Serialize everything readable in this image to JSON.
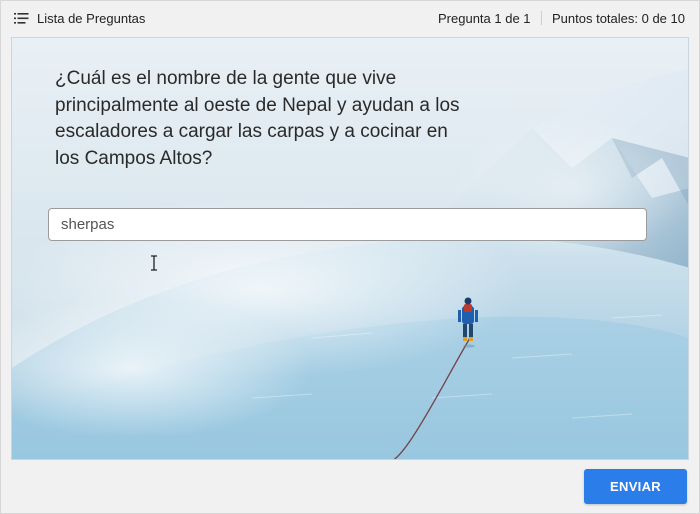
{
  "header": {
    "question_list_label": "Lista de Preguntas",
    "question_list_icon": "list-icon",
    "question_counter": "Pregunta 1 de 1",
    "total_points": "Puntos totales: 0 de 10"
  },
  "question": {
    "text": "¿Cuál es el nombre de la gente que vive principalmente al oeste de Nepal y ayudan a los escaladores a cargar las carpas y a cocinar en los Campos Altos?",
    "background_icon": "mountain-climber-snow-image"
  },
  "answer": {
    "value": "sherpas"
  },
  "footer": {
    "submit_label": "ENVIAR"
  },
  "colors": {
    "accent": "#2b7de9",
    "page_background": "#f1f1f1"
  }
}
